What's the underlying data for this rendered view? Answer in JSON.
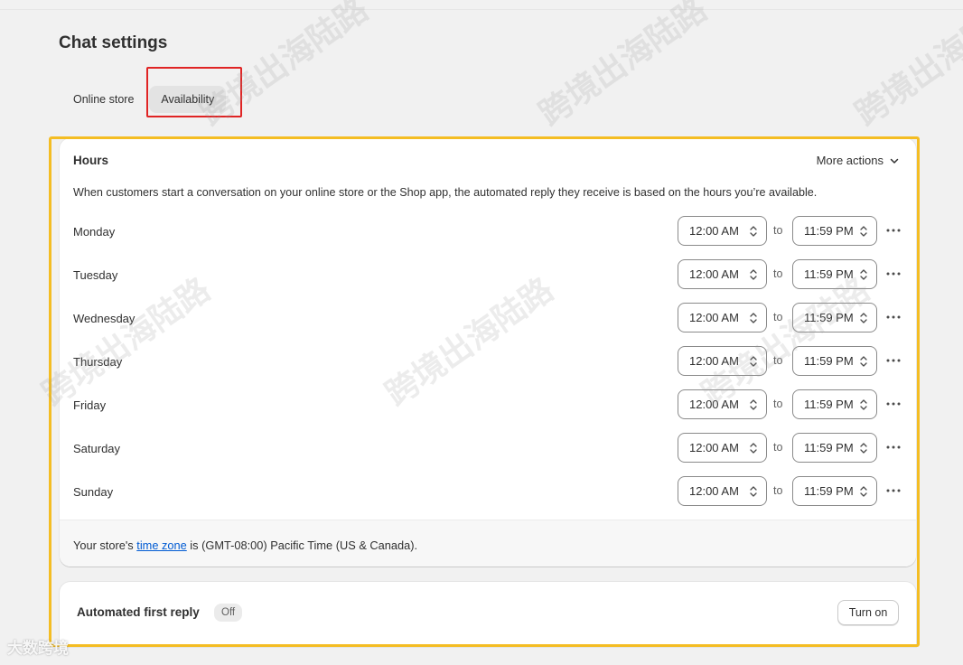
{
  "page": {
    "title": "Chat settings"
  },
  "tabs": [
    {
      "label": "Online store",
      "active": false
    },
    {
      "label": "Availability",
      "active": true
    }
  ],
  "hours_card": {
    "title": "Hours",
    "more_actions_label": "More actions",
    "description": "When customers start a conversation on your online store or the Shop app, the automated reply they receive is based on the hours you’re available.",
    "to_label": "to",
    "days": [
      {
        "day": "Monday",
        "from": "12:00 AM",
        "to": "11:59 PM"
      },
      {
        "day": "Tuesday",
        "from": "12:00 AM",
        "to": "11:59 PM"
      },
      {
        "day": "Wednesday",
        "from": "12:00 AM",
        "to": "11:59 PM"
      },
      {
        "day": "Thursday",
        "from": "12:00 AM",
        "to": "11:59 PM"
      },
      {
        "day": "Friday",
        "from": "12:00 AM",
        "to": "11:59 PM"
      },
      {
        "day": "Saturday",
        "from": "12:00 AM",
        "to": "11:59 PM"
      },
      {
        "day": "Sunday",
        "from": "12:00 AM",
        "to": "11:59 PM"
      }
    ],
    "footer": {
      "prefix": "Your store's ",
      "link": "time zone",
      "suffix": " is (GMT-08:00) Pacific Time (US & Canada)."
    }
  },
  "auto_reply_card": {
    "title": "Automated first reply",
    "status_badge": "Off",
    "button_label": "Turn on"
  },
  "watermark": {
    "text": "跨境出海陆路",
    "brand": "大数跨境"
  },
  "colors": {
    "highlight_red": "#e02424",
    "highlight_yellow": "#f4bd23",
    "link_blue": "#005bd3"
  }
}
